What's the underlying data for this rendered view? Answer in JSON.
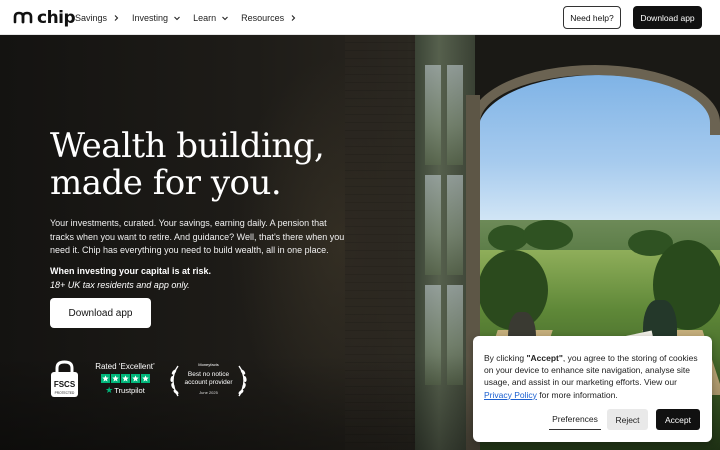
{
  "nav": {
    "logo_text": "chip",
    "items": [
      {
        "label": "Savings",
        "chevron": "chevron-right"
      },
      {
        "label": "Investing",
        "chevron": "chevron-down"
      },
      {
        "label": "Learn",
        "chevron": "chevron-down"
      },
      {
        "label": "Resources",
        "chevron": "chevron-right"
      }
    ],
    "help_label": "Need help?",
    "download_label": "Download app"
  },
  "hero": {
    "headline_line1": "Wealth building,",
    "headline_line2": "made for you.",
    "subtext": "Your investments, curated. Your savings, earning daily. A pension that tracks when you want to retire. And guidance? Well, that's there when you need it. Chip has everything you need to build wealth, all in one place.",
    "risk_bold": "When investing your capital is at risk.",
    "risk_italic": "18+ UK tax residents and app only.",
    "cta_label": "Download app"
  },
  "badges": {
    "fscs_text": "FSCS",
    "fscs_sub": "PROTECTED",
    "trustpilot_rating": "Rated ‘Excellent’",
    "trustpilot_stars": 5,
    "trustpilot_brand": "Trustpilot",
    "award_source": "Moneyfacts",
    "award_line1": "Best no notice",
    "award_line2": "account provider",
    "award_date": "June 2025"
  },
  "cookie": {
    "text_before": "By clicking ",
    "text_bold": "\"Accept\"",
    "text_after": ", you agree to the storing of cookies on your device to enhance site navigation, analyse site usage, and assist in our marketing efforts. View our ",
    "link_text": "Privacy Policy",
    "text_end": " for more information.",
    "preferences_label": "Preferences",
    "reject_label": "Reject",
    "accept_label": "Accept"
  },
  "colors": {
    "brand_dark": "#111111",
    "trustpilot_green": "#00b67a",
    "link_blue": "#1a5fd0"
  }
}
